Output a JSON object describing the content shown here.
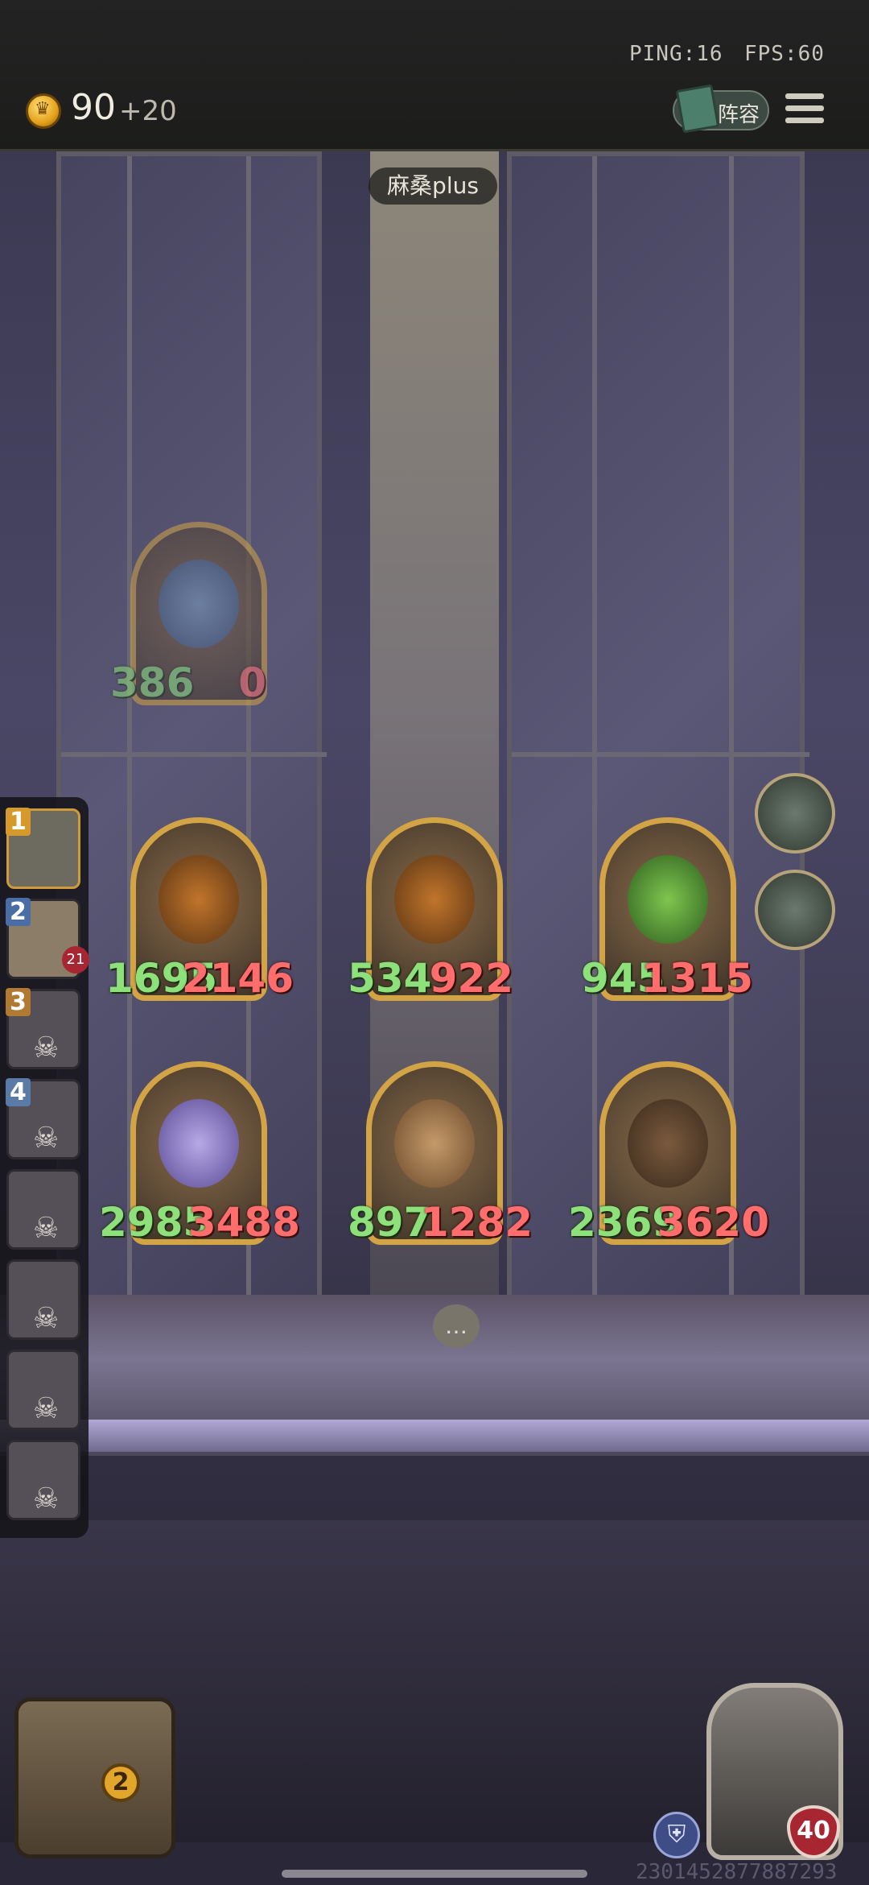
{
  "status": {
    "ping": "PING:16",
    "fps": "FPS:60"
  },
  "economy": {
    "gold": "90",
    "income": "+20"
  },
  "toolbar": {
    "roster_label": "阵容"
  },
  "opponent": {
    "name": "麻桑plus"
  },
  "shop_card": {
    "attack": "386",
    "health": "0"
  },
  "board": {
    "row1": [
      {
        "attack": "1695",
        "health": "2146"
      },
      {
        "attack": "534",
        "health": "922"
      },
      {
        "attack": "945",
        "health": "1315"
      }
    ],
    "row2": [
      {
        "attack": "2985",
        "health": "3488"
      },
      {
        "attack": "897",
        "health": "1282"
      },
      {
        "attack": "2369",
        "health": "3620"
      }
    ]
  },
  "leaderboard": {
    "slots": [
      {
        "rank": "1",
        "state": "active"
      },
      {
        "rank": "2",
        "state": "alive",
        "health": "21"
      },
      {
        "rank": "3",
        "state": "dead"
      },
      {
        "rank": "4",
        "state": "dead"
      },
      {
        "rank": "",
        "state": "dead"
      },
      {
        "rank": "",
        "state": "dead"
      },
      {
        "rank": "",
        "state": "dead"
      },
      {
        "rank": "",
        "state": "dead"
      }
    ]
  },
  "player": {
    "health": "40",
    "chest_count": "2",
    "id": "2301452877887293"
  },
  "colors": {
    "attack": "#8ee07b",
    "health": "#ff6d6d",
    "gold_frame": "#d3a446"
  }
}
